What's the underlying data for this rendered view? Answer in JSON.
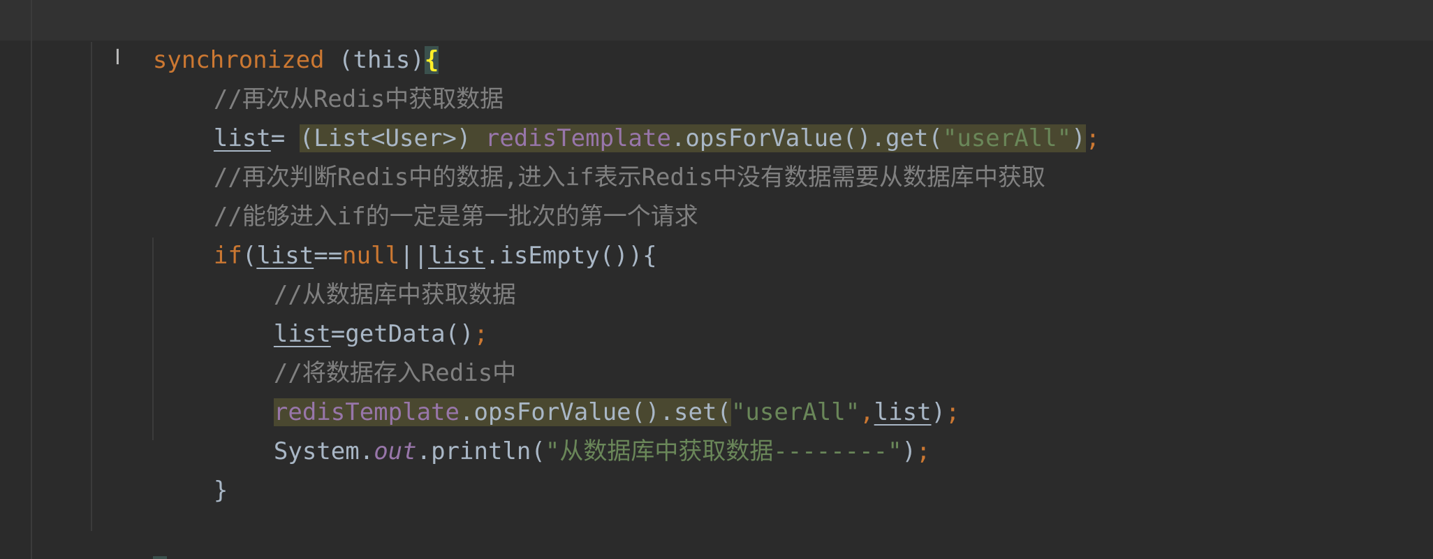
{
  "editor": {
    "lines": {
      "sync": {
        "kw": "synchronized",
        "rest": " (this)",
        "brace": "{"
      },
      "c1": "//再次从Redis中获取数据",
      "assign": {
        "var": "list",
        "eq": "= ",
        "cast": "(List<User>) ",
        "field": "redisTemplate",
        "call": ".opsForValue().get(",
        "str": "\"userAll\"",
        "close": ")",
        "semi": ";"
      },
      "c2": "//再次判断Redis中的数据,进入if表示Redis中没有数据需要从数据库中获取",
      "c3": "//能够进入if的一定是第一批次的第一个请求",
      "ifline": {
        "kw": "if",
        "p1": "(",
        "var1": "list",
        "op": "==",
        "null": "null",
        "or": "||",
        "var2": "list",
        "rest": ".isEmpty()){"
      },
      "c4": "//从数据库中获取数据",
      "getdata": {
        "var": "list",
        "rest": "=getData()",
        "semi": ";"
      },
      "c5": "//将数据存入Redis中",
      "set": {
        "field": "redisTemplate",
        "call": ".opsForValue().set(",
        "str": "\"userAll\"",
        "comma": ",",
        "var": "list",
        "close": ")",
        "semi": ";"
      },
      "print": {
        "cls": "System.",
        "out": "out",
        "call": ".println(",
        "str": "\"从数据库中获取数据--------\"",
        "close": ")",
        "semi": ";"
      },
      "close_if": "}",
      "close_sync": "}"
    },
    "colors": {
      "background": "#2b2b2b",
      "keyword": "#cc7832",
      "comment": "#808080",
      "string": "#6a8759",
      "field": "#9876aa",
      "text": "#a9b7c6",
      "brace_match": "#ffef28"
    },
    "cursor_icon": "text-cursor-icon"
  }
}
